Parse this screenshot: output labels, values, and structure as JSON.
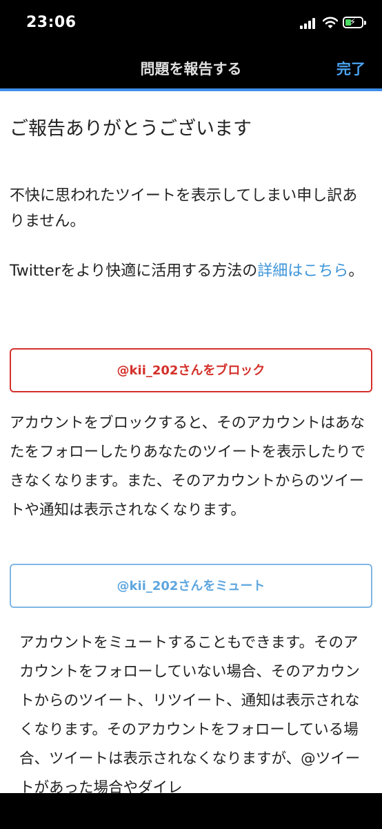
{
  "status": {
    "time": "23:06"
  },
  "nav": {
    "title": "問題を報告する",
    "done": "完了"
  },
  "main": {
    "heading": "ご報告ありがとうございます",
    "sorry": "不快に思われたツイートを表示してしまい申し訳ありません。",
    "learn_prefix": "Twitterをより快適に活用する方法の",
    "learn_link": "詳細はこちら",
    "learn_suffix": "。",
    "block_button": "@kii_202さんをブロック",
    "block_desc": "アカウントをブロックすると、そのアカウントはあなたをフォローしたりあなたのツイートを表示したりできなくなります。また、そのアカウントからのツイートや通知は表示されなくなります。",
    "mute_button": "@kii_202さんをミュート",
    "mute_desc": "アカウントをミュートすることもできます。そのアカウントをフォローしていない場合、そのアカウントからのツイート、リツイート、通知は表示されなくなります。そのアカウントをフォローしている場合、ツイートは表示されなくなりますが、@ツイートがあった場合やダイレ"
  },
  "colors": {
    "accent": "#3b94d9",
    "danger": "#d4302a",
    "battery": "#4cd964"
  },
  "icons": [
    "signal-icon",
    "wifi-icon",
    "battery-charging-icon"
  ]
}
